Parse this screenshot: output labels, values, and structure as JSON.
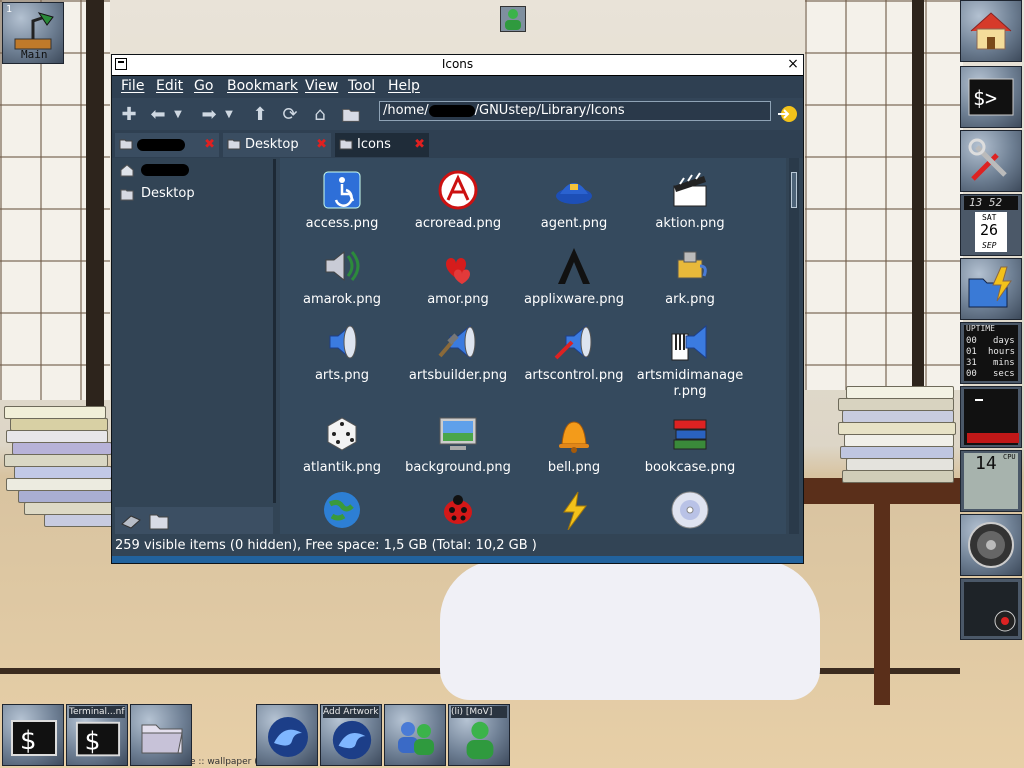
{
  "workspace": {
    "number": "1",
    "name": "Main"
  },
  "window": {
    "title": "Icons",
    "close_glyph": "×",
    "menus": [
      "File",
      "Edit",
      "Go",
      "Bookmark",
      "View",
      "Tool",
      "Help"
    ],
    "path_prefix": "/home/",
    "path_suffix": "/GNUstep/Library/Icons",
    "tabs": [
      {
        "label": "",
        "redacted": true
      },
      {
        "label": "Desktop"
      },
      {
        "label": "Icons",
        "active": true
      }
    ],
    "tab_close_glyph": "✖",
    "sidebar": [
      {
        "label": "",
        "redacted": true,
        "icon": "home-icon"
      },
      {
        "label": "Desktop",
        "icon": "desktop-icon"
      }
    ],
    "files": [
      "access.png",
      "acroread.png",
      "agent.png",
      "aktion.png",
      "amarok.png",
      "amor.png",
      "applixware.png",
      "ark.png",
      "arts.png",
      "artsbuilder.png",
      "artscontrol.png",
      "artsmidimanager.png",
      "atlantik.png",
      "background.png",
      "bell.png",
      "bookcase.png",
      "",
      "",
      "",
      ""
    ],
    "status": "259 visible items (0 hidden), Free space: 1,5 GB (Total: 10,2 GB )"
  },
  "dock": {
    "clock_time": "13 52",
    "clock_day": "SAT",
    "clock_date": "26",
    "clock_month": "SEP",
    "uptime_label": "UPTIME",
    "uptime_rows": [
      {
        "num": "00",
        "unit": "days"
      },
      {
        "num": "01",
        "unit": "hours"
      },
      {
        "num": "31",
        "unit": "mins"
      },
      {
        "num": "00",
        "unit": "secs"
      }
    ],
    "cpu_value": "14",
    "cpu_label": "CPU"
  },
  "taskbar": {
    "captions": [
      "",
      "Terminal...nfoo:/",
      "",
      "",
      "Add Artwork...f",
      "",
      "(li) [MoV]"
    ],
    "wallpaper_credit": "e :: wallpaper (c"
  }
}
